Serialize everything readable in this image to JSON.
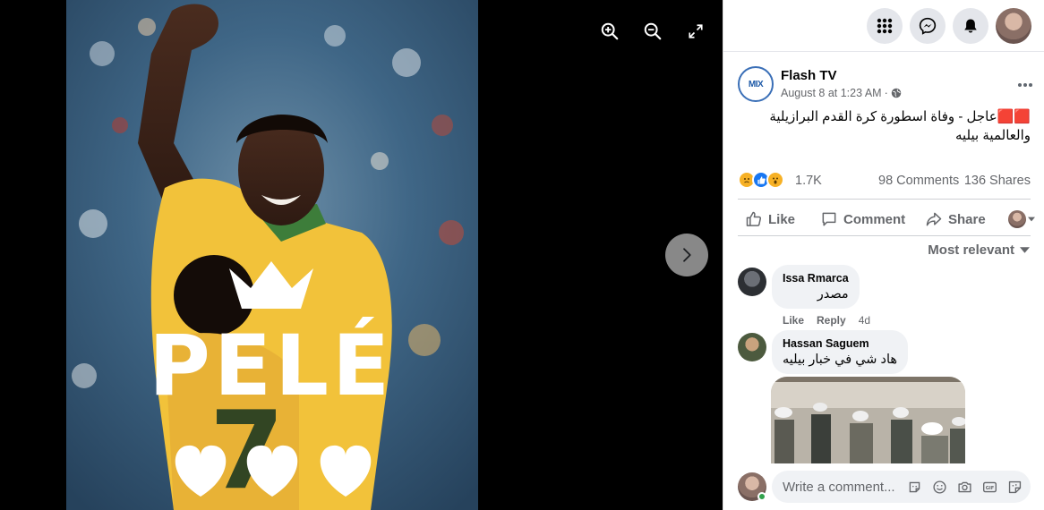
{
  "viewer": {
    "photo_text": "PELÉ",
    "icons": [
      "zoom-in-icon",
      "zoom-out-icon",
      "fullscreen-icon",
      "chevron-right-icon"
    ]
  },
  "topbar": {
    "icons": [
      "menu-grid-icon",
      "messenger-icon",
      "notifications-bell-icon",
      "profile-avatar"
    ]
  },
  "post": {
    "page_name": "Flash TV",
    "logo_text": "MIX",
    "timestamp": "August 8 at 1:23 AM",
    "separator": "·",
    "text": "🟥🟥عاجل - وفاة اسطورة كرة القدم البرازيلية والعالمية بيليه",
    "reaction_count": "1.7K",
    "comments_count": "98 Comments",
    "shares_count": "136 Shares",
    "reactions": [
      "sad",
      "like",
      "wow"
    ]
  },
  "actions": {
    "like": "Like",
    "comment": "Comment",
    "share": "Share"
  },
  "sort_label": "Most relevant",
  "comments": [
    {
      "name": "Issa Rmarca",
      "text": "مصدر",
      "like": "Like",
      "reply": "Reply",
      "time": "4d"
    },
    {
      "name": "Hassan Saguem",
      "text": "هاد شي في خبار بيليه"
    }
  ],
  "composer": {
    "placeholder": "Write a comment..."
  },
  "colors": {
    "viewer_bg": "#000000",
    "jersey_yellow": "#f2c23a",
    "accent_blue": "#1877f2",
    "online_green": "#31a24c"
  }
}
